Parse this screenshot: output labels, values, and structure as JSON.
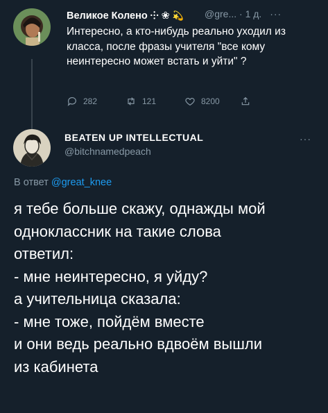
{
  "tweet1": {
    "author_name": "Великое Колено ⸭ ❀",
    "handle": "@gre...",
    "separator": "·",
    "time": "1 д.",
    "more": "···",
    "text": "Интересно, а кто-нибудь реально уходил из класса, после фразы учителя \"все кому неинтересно может встать и уйти\" ?",
    "actions": {
      "replies": "282",
      "retweets": "121",
      "likes": "8200"
    }
  },
  "tweet2": {
    "author_name": "BEATEN UP INTELLECTUAL",
    "handle": "@bitchnamedpeach",
    "more": "···",
    "reply_prefix": "В ответ",
    "reply_to": "@great_knee",
    "lines": [
      "я тебе больше скажу, однажды мой",
      "одноклассник на такие слова",
      "ответил:",
      "- мне неинтересно, я уйду?",
      "а учительница сказала:",
      "- мне тоже, пойдём вместе",
      "и они ведь реально вдвоём вышли",
      "из кабинета"
    ]
  },
  "colors": {
    "background": "#15202b",
    "text": "#ffffff",
    "secondary": "#8899a6",
    "accent": "#1d9bf0"
  }
}
